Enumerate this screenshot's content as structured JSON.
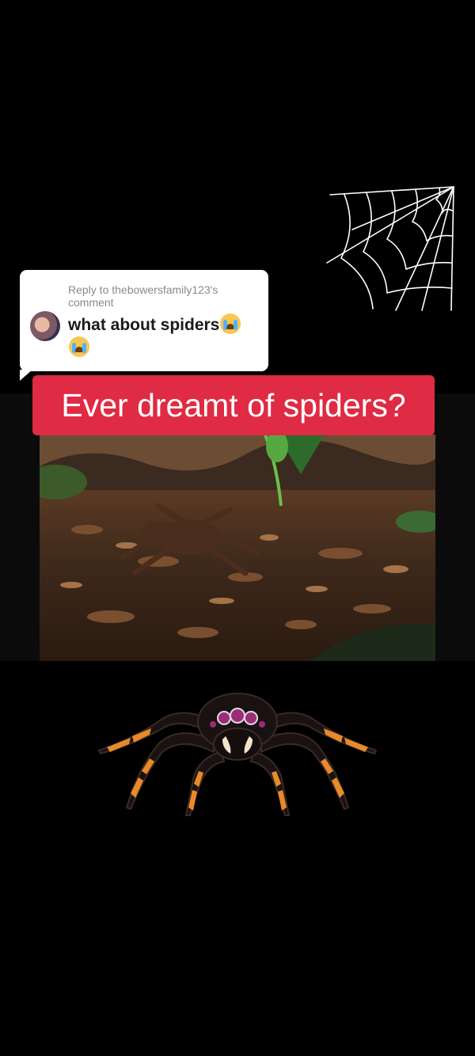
{
  "comment_reply": {
    "reply_label": "Reply to thebowersfamily123's comment",
    "comment_text": "what about spiders",
    "emoji_name": "loudly-crying-face-emoji"
  },
  "caption": {
    "text": "Ever dreamt of spiders?",
    "background_color": "#df2b43"
  },
  "decor": {
    "web_icon": "spider-web-icon",
    "spider_icon": "cartoon-spider-icon"
  },
  "colors": {
    "background": "#000000",
    "spider_orange": "#e8892a"
  }
}
